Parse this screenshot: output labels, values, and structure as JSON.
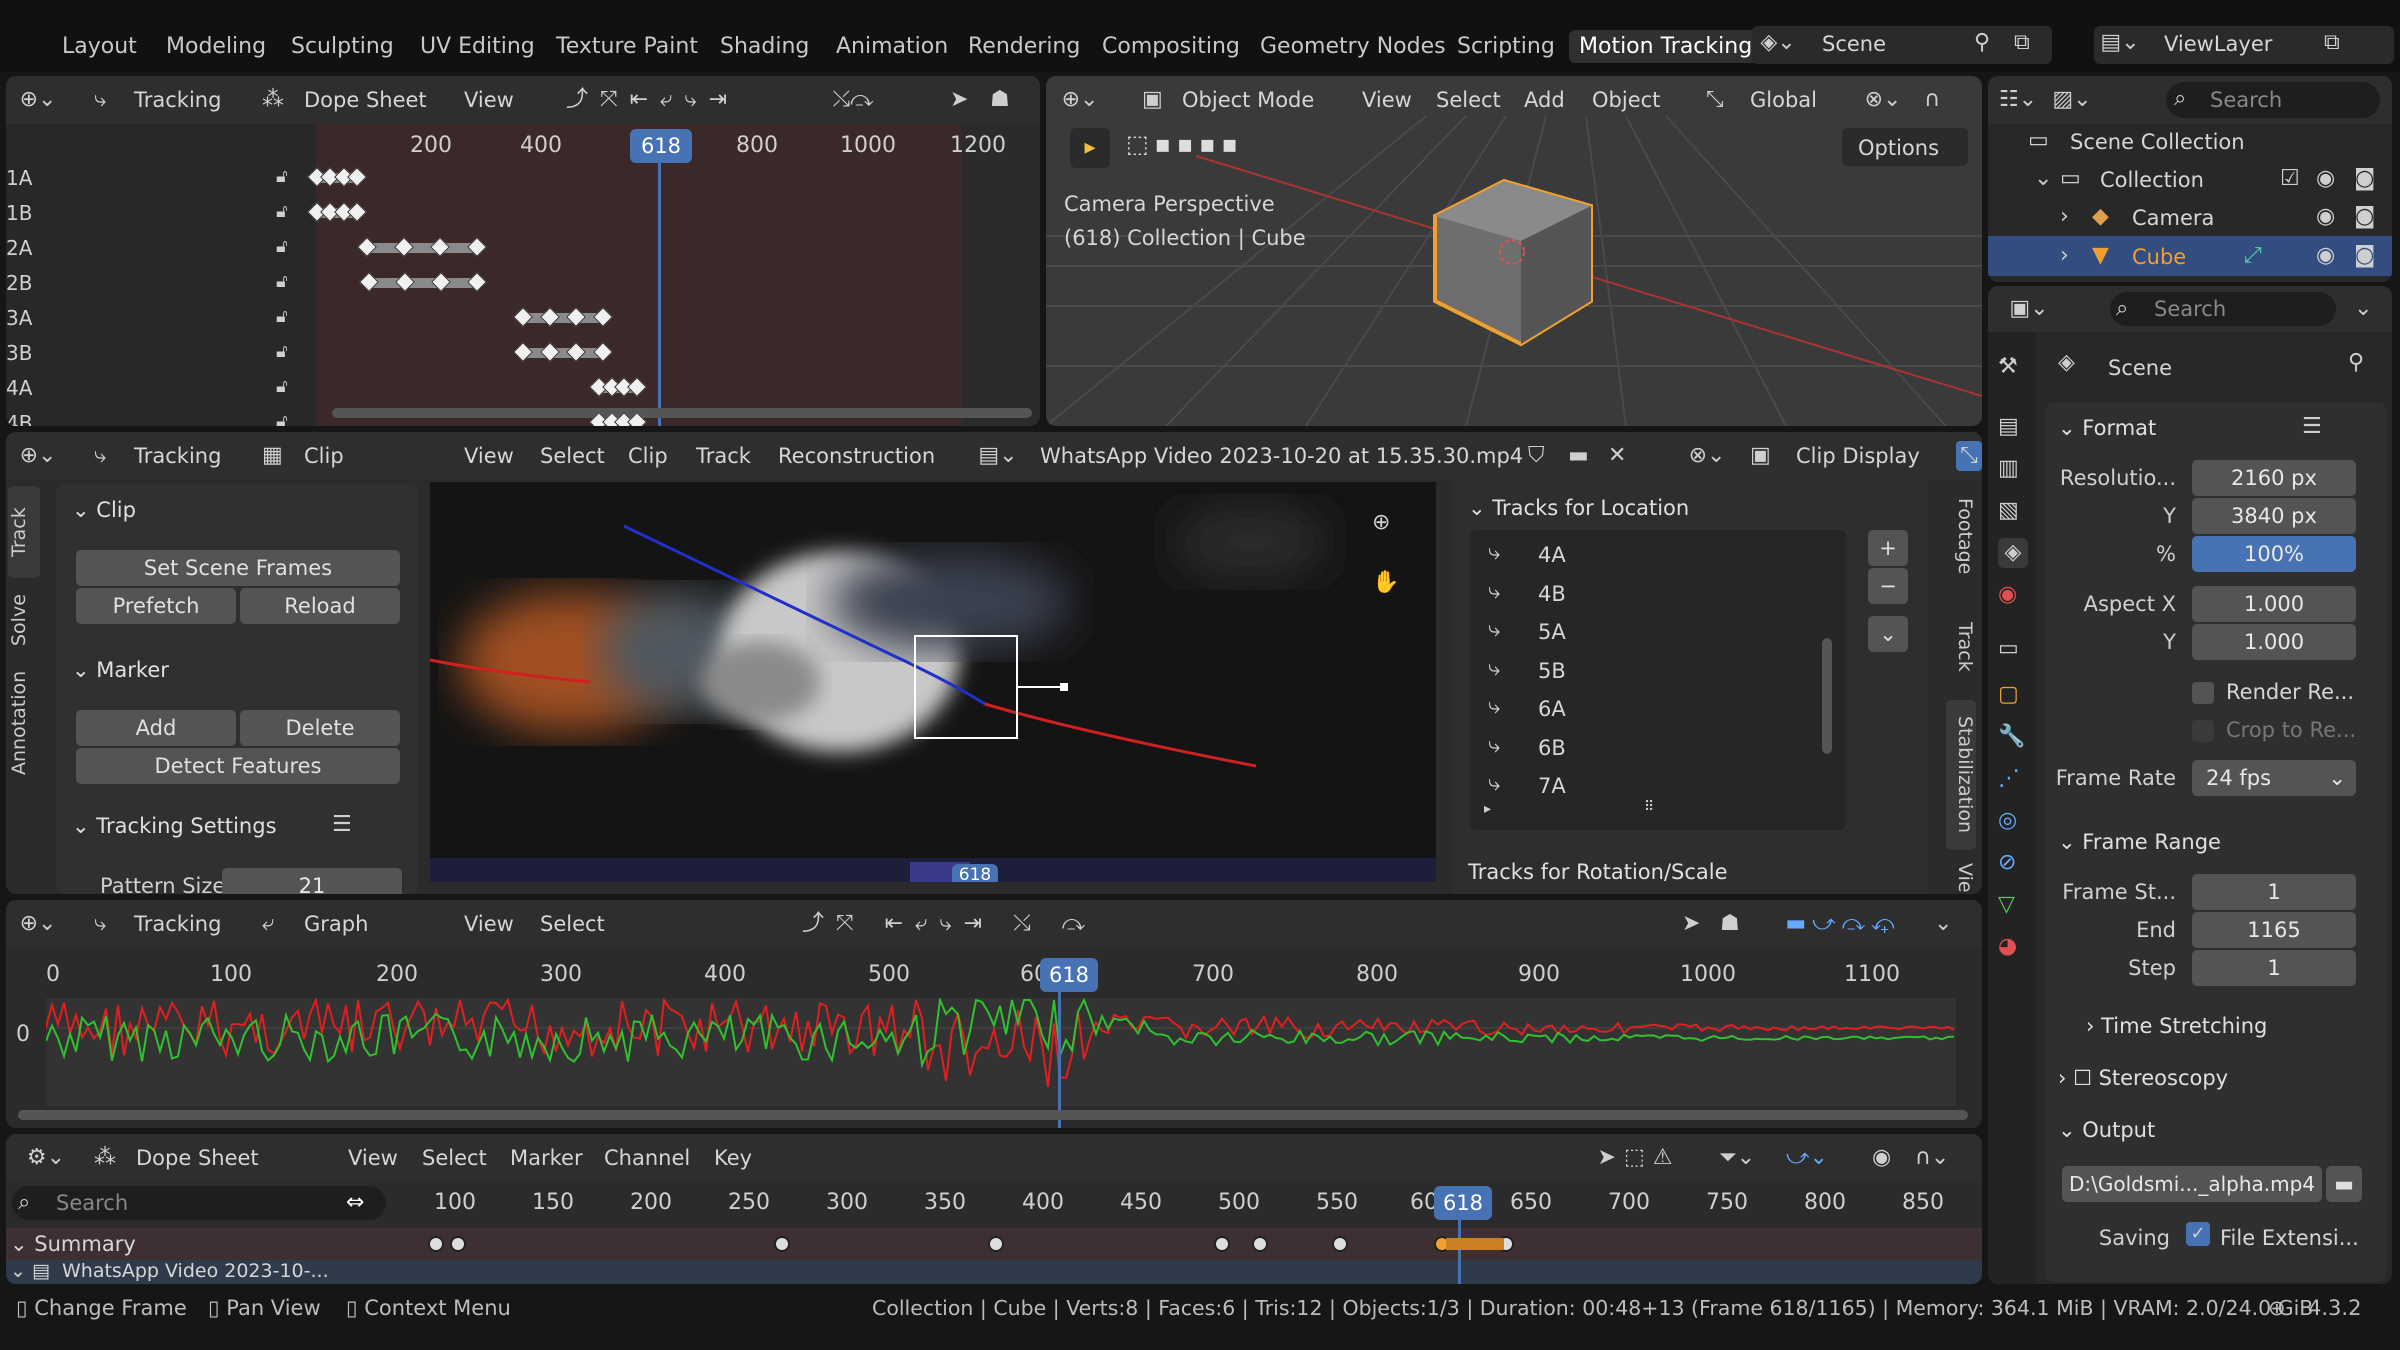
{
  "workspaces": [
    "Layout",
    "Modeling",
    "Sculpting",
    "UV Editing",
    "Texture Paint",
    "Shading",
    "Animation",
    "Rendering",
    "Compositing",
    "Geometry Nodes",
    "Scripting",
    "Motion Tracking"
  ],
  "active_workspace": "Motion Tracking",
  "scene": {
    "name": "Scene",
    "view_layer": "ViewLayer"
  },
  "top_dope": {
    "mode": "Tracking",
    "editor": "Dope Sheet",
    "menu": "View",
    "ticks": [
      "200",
      "400",
      "618",
      "800",
      "1000",
      "1200"
    ],
    "current_frame": "618",
    "rows": [
      "1A",
      "1B",
      "2A",
      "2B",
      "3A",
      "3B",
      "4A",
      "4B"
    ]
  },
  "viewport": {
    "mode": "Object Mode",
    "menus": [
      "View",
      "Select",
      "Add",
      "Object"
    ],
    "orientation": "Global",
    "options": "Options",
    "info_line1": "Camera Perspective",
    "info_line2": "(618) Collection | Cube"
  },
  "outliner": {
    "search": "Search",
    "items": [
      "Scene Collection",
      "Collection",
      "Camera",
      "Cube"
    ]
  },
  "clip_editor": {
    "mode": "Tracking",
    "editor": "Clip",
    "menus": [
      "View",
      "Select",
      "Clip",
      "Track",
      "Reconstruction"
    ],
    "clip_name": "WhatsApp Video 2023-10-20 at 15.35.30.mp4",
    "display": "Clip Display",
    "frame": "618"
  },
  "clip_sidebar": {
    "tabs": [
      "Track",
      "Solve",
      "Annotation"
    ],
    "clip_section": "Clip",
    "set_scene_frames": "Set Scene Frames",
    "prefetch": "Prefetch",
    "reload": "Reload",
    "marker_section": "Marker",
    "add": "Add",
    "delete": "Delete",
    "detect": "Detect Features",
    "tracking_settings": "Tracking Settings",
    "pattern_size_label": "Pattern Size",
    "pattern_size": "21"
  },
  "stabilization": {
    "tracks_location": "Tracks for Location",
    "tracks": [
      "4A",
      "4B",
      "5A",
      "5B",
      "6A",
      "6B",
      "7A"
    ],
    "tracks_rotation": "Tracks for Rotation/Scale",
    "right_tabs": [
      "Footage",
      "Track",
      "Stabilization",
      "Vie"
    ]
  },
  "graph": {
    "mode": "Tracking",
    "editor": "Graph",
    "menus": [
      "View",
      "Select"
    ],
    "ticks": [
      "0",
      "100",
      "200",
      "300",
      "400",
      "500",
      "60",
      "618",
      "700",
      "800",
      "900",
      "1000",
      "1100"
    ],
    "y_label": "0"
  },
  "dope_bottom": {
    "editor": "Dope Sheet",
    "menus": [
      "View",
      "Select",
      "Marker",
      "Channel",
      "Key"
    ],
    "search": "Search",
    "ticks": [
      "100",
      "150",
      "200",
      "250",
      "300",
      "350",
      "400",
      "450",
      "500",
      "550",
      "60",
      "618",
      "650",
      "700",
      "750",
      "800",
      "850"
    ],
    "summary": "Summary",
    "channel": "WhatsApp Video 2023-10-..."
  },
  "properties": {
    "search": "Search",
    "scene": "Scene",
    "format": "Format",
    "resolution_x_label": "Resolutio...",
    "resolution_x": "2160 px",
    "resolution_y_label": "Y",
    "resolution_y": "3840 px",
    "percent_label": "%",
    "percent": "100%",
    "aspect_x_label": "Aspect X",
    "aspect_x": "1.000",
    "aspect_y_label": "Y",
    "aspect_y": "1.000",
    "render_region": "Render Re...",
    "crop": "Crop to Re...",
    "frame_rate_label": "Frame Rate",
    "frame_rate": "24 fps",
    "frame_range": "Frame Range",
    "frame_start_label": "Frame St...",
    "frame_start": "1",
    "end_label": "End",
    "end": "1165",
    "step_label": "Step",
    "step": "1",
    "time_stretching": "Time Stretching",
    "stereoscopy": "Stereoscopy",
    "output": "Output",
    "output_path": "D:\\Goldsmi..._alpha.mp4",
    "saving_label": "Saving",
    "file_ext": "File Extensi..."
  },
  "status": {
    "change_frame": "Change Frame",
    "pan_view": "Pan View",
    "context_menu": "Context Menu",
    "stats": "Collection | Cube | Verts:8 | Faces:6 | Tris:12 | Objects:1/3 | Duration: 00:48+13 (Frame 618/1165) | Memory: 364.1 MiB | VRAM: 2.0/24.0 GiB",
    "version": "4.3.2"
  },
  "colors": {
    "accent": "#4772b3",
    "orange": "#f0a030"
  }
}
